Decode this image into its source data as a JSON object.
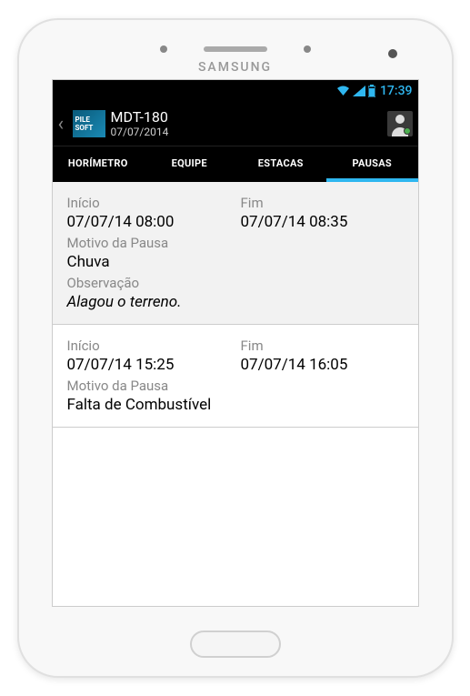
{
  "status_bar": {
    "time": "17:39"
  },
  "action_bar": {
    "logo_line1": "PILE",
    "logo_line2": "SOFT",
    "title": "MDT-180",
    "subtitle": "07/07/2014"
  },
  "tabs": {
    "0": {
      "label": "HORÍMETRO"
    },
    "1": {
      "label": "EQUIPE"
    },
    "2": {
      "label": "ESTACAS"
    },
    "3": {
      "label": "PAUSAS"
    }
  },
  "fields": {
    "inicio_label": "Início",
    "fim_label": "Fim",
    "motivo_label": "Motivo da Pausa",
    "observacao_label": "Observação"
  },
  "pauses": {
    "0": {
      "inicio": "07/07/14 08:00",
      "fim": "07/07/14 08:35",
      "motivo": "Chuva",
      "observacao": "Alagou o terreno."
    },
    "1": {
      "inicio": "07/07/14 15:25",
      "fim": "07/07/14 16:05",
      "motivo": "Falta de Combustível"
    }
  },
  "device": {
    "brand": "SAMSUNG"
  }
}
